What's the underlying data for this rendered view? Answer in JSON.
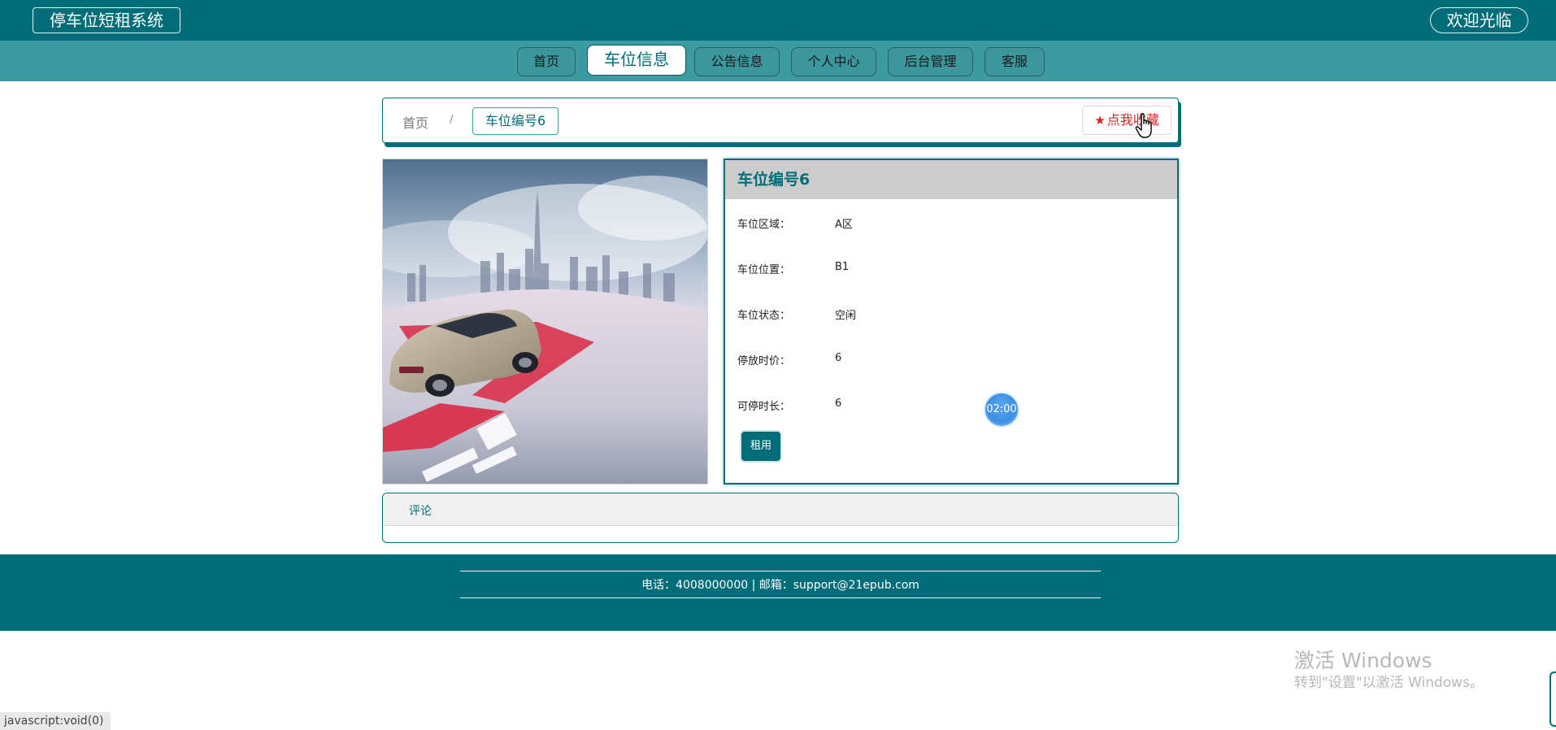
{
  "header": {
    "site_title": "停车位短租系统",
    "welcome": "欢迎光临"
  },
  "nav": {
    "items": [
      {
        "label": "首页"
      },
      {
        "label": "车位信息"
      },
      {
        "label": "公告信息"
      },
      {
        "label": "个人中心"
      },
      {
        "label": "后台管理"
      },
      {
        "label": "客服"
      }
    ],
    "active_index": 1
  },
  "breadcrumb": {
    "home": "首页",
    "separator": "/",
    "current": "车位编号6"
  },
  "favorite_button": {
    "label": "点我收藏",
    "icon": "star-icon"
  },
  "detail": {
    "title": "车位编号6",
    "fields": [
      {
        "label": "车位区域：",
        "value": "A区"
      },
      {
        "label": "车位位置：",
        "value": "B1"
      },
      {
        "label": "车位状态：",
        "value": "空闲"
      },
      {
        "label": "停放时价：",
        "value": "6"
      },
      {
        "label": "可停时长：",
        "value": "6"
      }
    ],
    "rent_button": "租用"
  },
  "timer_badge": "02:00",
  "comments": {
    "tab_label": "评论"
  },
  "footer": {
    "contact": "电话：4008000000 | 邮箱：support@21epub.com"
  },
  "os_watermark": {
    "title": "激活 Windows",
    "subtitle": "转到\"设置\"以激活 Windows。"
  },
  "status_bar": {
    "text": "javascript:void(0)"
  },
  "colors": {
    "primary": "#006d78",
    "nav_bg": "#3d9aa0",
    "favorite": "#e02020",
    "detail_header_bg": "#cccccc"
  }
}
